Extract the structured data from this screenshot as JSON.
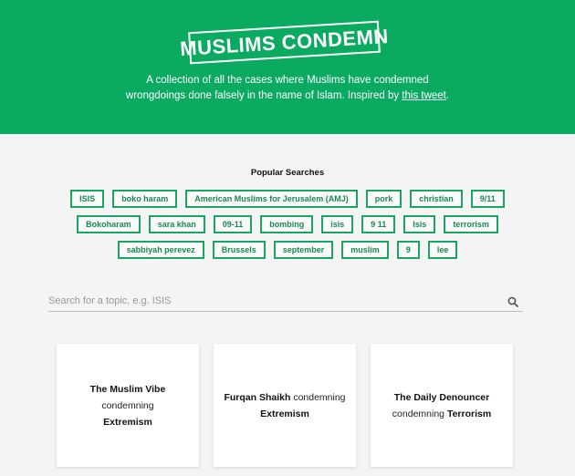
{
  "header": {
    "logo_text": "MUSLIMS CONDEMN",
    "tagline_line1": "A collection of all the cases where Muslims have condemned",
    "tagline_line2": "wrongdoings done falsely in the name of Islam. Inspired by",
    "tagline_link": "this tweet",
    "tagline_end": "."
  },
  "popular": {
    "title": "Popular Searches",
    "rows": [
      [
        "ISIS",
        "boko haram",
        "American Muslims for Jerusalem (AMJ)",
        "pork",
        "christian",
        "9/11"
      ],
      [
        "Bokoharam",
        "sara khan",
        "09-11",
        "bombing",
        "isis",
        "9 11",
        "Isis",
        "terrorism"
      ],
      [
        "sabbiyah perevez",
        "Brussels",
        "september",
        "muslim",
        "9",
        "lee"
      ]
    ]
  },
  "search": {
    "placeholder": "Search for a topic, e.g. ISIS",
    "value": ""
  },
  "cards": [
    {
      "source": "The Muslim Vibe",
      "verb": "condemning",
      "topic": "Extremism"
    },
    {
      "source": "Furqan Shaikh",
      "verb": "condemning",
      "topic": "Extremism"
    },
    {
      "source": "The Daily Denouncer",
      "verb": "condemning",
      "topic": "Terrorism"
    }
  ],
  "colors": {
    "brand_green": "#0aab60",
    "tag_border": "#1aa563"
  }
}
